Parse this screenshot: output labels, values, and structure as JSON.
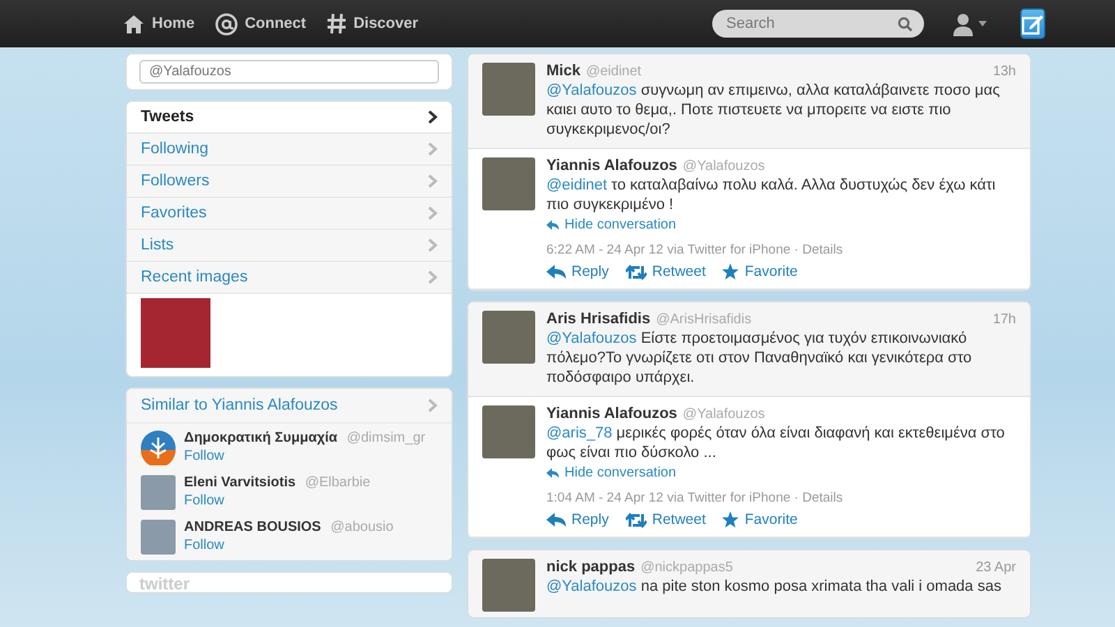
{
  "topbar": {
    "nav": [
      {
        "kind": "home",
        "label": "Home"
      },
      {
        "kind": "connect",
        "label": "Connect"
      },
      {
        "kind": "discover",
        "label": "Discover"
      }
    ],
    "search": {
      "placeholder": "Search"
    }
  },
  "sidebar": {
    "compose_placeholder": "@Yalafouzos",
    "nav_items": [
      {
        "label": "Tweets",
        "selected": true
      },
      {
        "label": "Following",
        "selected": false
      },
      {
        "label": "Followers",
        "selected": false
      },
      {
        "label": "Favorites",
        "selected": false
      },
      {
        "label": "Lists",
        "selected": false
      },
      {
        "label": "Recent images",
        "selected": false
      }
    ],
    "similar": {
      "title": "Similar to Yiannis Alafouzos",
      "accounts": [
        {
          "kind": "logo",
          "name": "Δημοκρατική Συμμαχία",
          "handle": "@dimsim_gr",
          "follow": "Follow"
        },
        {
          "kind": "photo",
          "name": "Eleni Varvitsiotis",
          "handle": "@Elbarbie",
          "follow": "Follow"
        },
        {
          "kind": "photo",
          "name": "ANDREAS BOUSIOS",
          "handle": "@abousio",
          "follow": "Follow"
        }
      ]
    },
    "footer_logo": "twitter"
  },
  "conversations": [
    {
      "tweet": {
        "name": "Mick",
        "handle": "@eidinet",
        "time": "13h",
        "mention": "@Yalafouzos",
        "text": "συγνωμη αν επιμεινω, αλλα καταλάβαινετε ποσο μας καιει αυτο το θεμα,. Ποτε πιστευετε να μπορειτε να ειστε πιο συγκεκριμενος/οι?"
      },
      "reply": {
        "name": "Yiannis Alafouzos",
        "handle": "@Yalafouzos",
        "mention": "@eidinet",
        "text": "το καταλαβαίνω πολυ καλά. Αλλα δυστυχώς δεν έχω κάτι πιο συγκεκριμένο !",
        "hide": "Hide conversation",
        "meta": "6:22 AM - 24 Apr 12 via Twitter for iPhone ·",
        "details": "Details",
        "actions": [
          "Reply",
          "Retweet",
          "Favorite"
        ]
      }
    },
    {
      "tweet": {
        "name": "Aris Hrisafidis",
        "handle": "@ArisHrisafidis",
        "time": "17h",
        "mention": "@Yalafouzos",
        "text": "Είστε προετοιμασμένος για τυχόν επικοινωνιακό πόλεμο?Το γνωρίζετε οτι στον Παναθηναϊκό και γενικότερα στο ποδόσφαιρο υπάρχει."
      },
      "reply": {
        "name": "Yiannis Alafouzos",
        "handle": "@Yalafouzos",
        "mention": "@aris_78",
        "text": "μερικές φορές όταν όλα είναι διαφανή και εκτεθειμένα στο φως είναι πιο δύσκολο ...",
        "hide": "Hide conversation",
        "meta": "1:04 AM - 24 Apr 12 via Twitter for iPhone ·",
        "details": "Details",
        "actions": [
          "Reply",
          "Retweet",
          "Favorite"
        ]
      }
    }
  ],
  "last_tweet": {
    "name": "nick pappas",
    "handle": "@nickpappas5",
    "time": "23 Apr",
    "mention": "@Yalafouzos",
    "text": "na pite ston kosmo posa xrimata tha vali i omada sas"
  }
}
